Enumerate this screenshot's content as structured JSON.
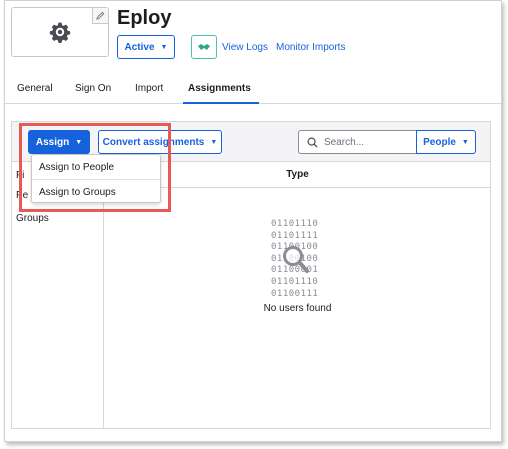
{
  "app": {
    "title": "Eploy",
    "status_label": "Active",
    "links": [
      "View Logs",
      "Monitor Imports"
    ]
  },
  "tabs": [
    {
      "label": "General",
      "active": false
    },
    {
      "label": "Sign On",
      "active": false
    },
    {
      "label": "Import",
      "active": false
    },
    {
      "label": "Assignments",
      "active": true
    }
  ],
  "toolbar": {
    "assign_label": "Assign",
    "convert_label": "Convert assignments",
    "search_placeholder": "Search...",
    "filter_label": "People"
  },
  "dropdown": {
    "items": [
      "Assign to People",
      "Assign to Groups"
    ]
  },
  "filters": {
    "partial_1": "Fi",
    "partial_2": "Pe",
    "groups": "Groups"
  },
  "table": {
    "column_type": "Type"
  },
  "empty_state": {
    "binary_lines": [
      "01101110",
      "01101111",
      "01100100",
      "01100100",
      "01100001",
      "01101110",
      "01100111"
    ],
    "message": "No users found"
  },
  "colors": {
    "accent": "#1662dd",
    "highlight": "#e55a54",
    "push_green": "#4cc4a8"
  },
  "icons": {
    "logo": "gear-icon",
    "edit": "pencil-icon",
    "push": "handshake-icon",
    "search": "search-icon",
    "empty": "magnifier-icon"
  }
}
